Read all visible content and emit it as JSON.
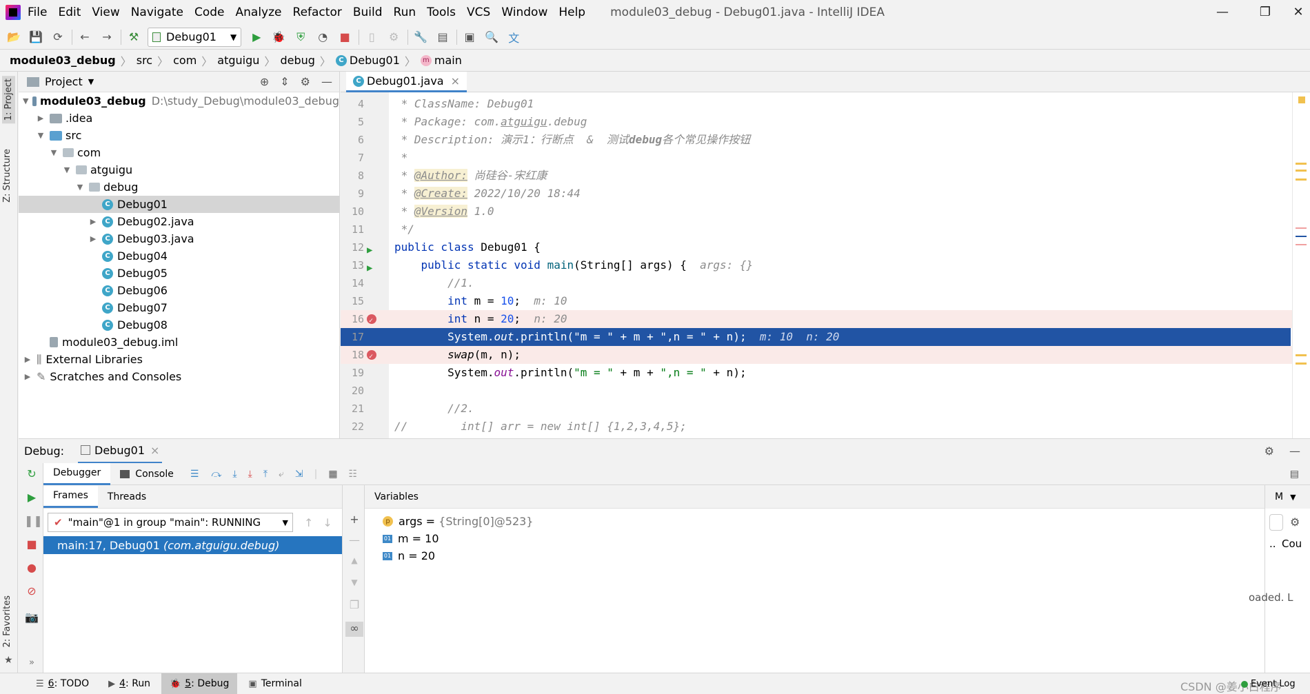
{
  "title_bar": {
    "menu": [
      "File",
      "Edit",
      "View",
      "Navigate",
      "Code",
      "Analyze",
      "Refactor",
      "Build",
      "Run",
      "Tools",
      "VCS",
      "Window",
      "Help"
    ],
    "window_title": "module03_debug - Debug01.java - IntelliJ IDEA",
    "minimize": "—",
    "restore": "❐",
    "close": "✕"
  },
  "toolbar": {
    "run_config": "Debug01"
  },
  "breadcrumb": {
    "items": [
      "module03_debug",
      "src",
      "com",
      "atguigu",
      "debug",
      "Debug01",
      "main"
    ]
  },
  "left_strip": {
    "project": "1: Project",
    "structure": "Z: Structure",
    "favorites": "2: Favorites"
  },
  "project_panel": {
    "title": "Project",
    "tree": [
      {
        "label": "module03_debug",
        "path": "D:\\study_Debug\\module03_debug",
        "arrow": "▼",
        "kind": "module"
      },
      {
        "label": ".idea",
        "arrow": "▶",
        "kind": "folder"
      },
      {
        "label": "src",
        "arrow": "▼",
        "kind": "folder"
      },
      {
        "label": "com",
        "arrow": "▼",
        "kind": "package"
      },
      {
        "label": "atguigu",
        "arrow": "▼",
        "kind": "package"
      },
      {
        "label": "debug",
        "arrow": "▼",
        "kind": "package"
      },
      {
        "label": "Debug01",
        "arrow": "",
        "kind": "class",
        "selected": true
      },
      {
        "label": "Debug02.java",
        "arrow": "▶",
        "kind": "class"
      },
      {
        "label": "Debug03.java",
        "arrow": "▶",
        "kind": "class"
      },
      {
        "label": "Debug04",
        "arrow": "",
        "kind": "class"
      },
      {
        "label": "Debug05",
        "arrow": "",
        "kind": "class"
      },
      {
        "label": "Debug06",
        "arrow": "",
        "kind": "class"
      },
      {
        "label": "Debug07",
        "arrow": "",
        "kind": "class"
      },
      {
        "label": "Debug08",
        "arrow": "",
        "kind": "class"
      },
      {
        "label": "module03_debug.iml",
        "arrow": "",
        "kind": "file"
      },
      {
        "label": "External Libraries",
        "arrow": "▶",
        "kind": "lib"
      },
      {
        "label": "Scratches and Consoles",
        "arrow": "▶",
        "kind": "scratch"
      }
    ]
  },
  "editor": {
    "tab": "Debug01.java",
    "tab_close": "×",
    "lines": [
      {
        "n": "4",
        "html": "<span class='cm'> * ClassName: Debug01</span>"
      },
      {
        "n": "5",
        "html": "<span class='cm'> * Package: com.<u>atguigu</u>.debug</span>"
      },
      {
        "n": "6",
        "html": "<span class='cm'> * Description: 演示1：行断点  &  测试<b>debug</b>各个常见操作按钮</span>"
      },
      {
        "n": "7",
        "html": "<span class='cm'> *</span>"
      },
      {
        "n": "8",
        "html": "<span class='cm'> * </span><span class='tag'>@Author:</span><span class='cm'> 尚硅谷-宋红康</span>"
      },
      {
        "n": "9",
        "html": "<span class='cm'> * </span><span class='tag'>@Create:</span><span class='cm'> 2022/10/20 18:44</span>"
      },
      {
        "n": "10",
        "html": "<span class='cm'> * </span><span class='tag'>@Version</span><span class='cm'> 1.0</span>"
      },
      {
        "n": "11",
        "html": "<span class='cm'> */</span>"
      },
      {
        "n": "12",
        "html": "<span class='kw'>public class</span> Debug01 {",
        "run": true
      },
      {
        "n": "13",
        "html": "    <span class='kw'>public static void</span> <span style='color:#00627a'>main</span>(String[] args) {  <span class='hint'>args: {}</span>",
        "run": true
      },
      {
        "n": "14",
        "html": "        <span class='cm'>//1.</span>"
      },
      {
        "n": "15",
        "html": "        <span class='kw'>int</span> m = <span class='num'>10</span>;  <span class='hint'>m: 10</span>"
      },
      {
        "n": "16",
        "html": "        <span class='kw'>int</span> n = <span class='num'>20</span>;  <span class='hint'>n: 20</span>",
        "bp": true
      },
      {
        "n": "17",
        "html": "        System.<span class='it'>out</span>.println(<span class='str'>\"m = \"</span> + m + <span class='str'>\",n = \"</span> + n);  <span class='hint'>m: 10  n: 20</span>",
        "cur": true
      },
      {
        "n": "18",
        "html": "        <span class='it'>swap</span>(m, n);",
        "bp": true
      },
      {
        "n": "19",
        "html": "        System.<span class='it' style='color:#871094'>out</span>.println(<span class='str'>\"m = \"</span> + m + <span class='str'>\",n = \"</span> + n);"
      },
      {
        "n": "20",
        "html": ""
      },
      {
        "n": "21",
        "html": "        <span class='cm'>//2.</span>"
      },
      {
        "n": "22",
        "html": "<span class='cm'>//        int[] arr = new int[] {1,2,3,4,5};</span>"
      }
    ]
  },
  "debug": {
    "label": "Debug:",
    "session": "Debug01",
    "session_close": "×",
    "tabs": [
      "Debugger",
      "Console"
    ],
    "frames_tabs": [
      "Frames",
      "Threads"
    ],
    "thread": "\"main\"@1 in group \"main\": RUNNING",
    "frame": "main:17, Debug01",
    "frame_pkg": "(com.atguigu.debug)",
    "variables_title": "Variables",
    "variables": [
      {
        "badge": "p",
        "name": "args",
        "eq": " = ",
        "value": "{String[0]@523}"
      },
      {
        "badge": "01",
        "name": "m",
        "eq": " = ",
        "value": "10"
      },
      {
        "badge": "01",
        "name": "n",
        "eq": " = ",
        "value": "20"
      }
    ],
    "right_clip": [
      "M",
      "Cou",
      "oaded. L"
    ]
  },
  "status_bar": {
    "tabs": [
      {
        "key": "6",
        "label": ": TODO"
      },
      {
        "key": "4",
        "label": ": Run"
      },
      {
        "key": "5",
        "label": ": Debug",
        "active": true
      },
      {
        "key": "",
        "label": "Terminal"
      }
    ],
    "event_log": "Event Log",
    "watermark": "CSDN @姜小白程序"
  }
}
